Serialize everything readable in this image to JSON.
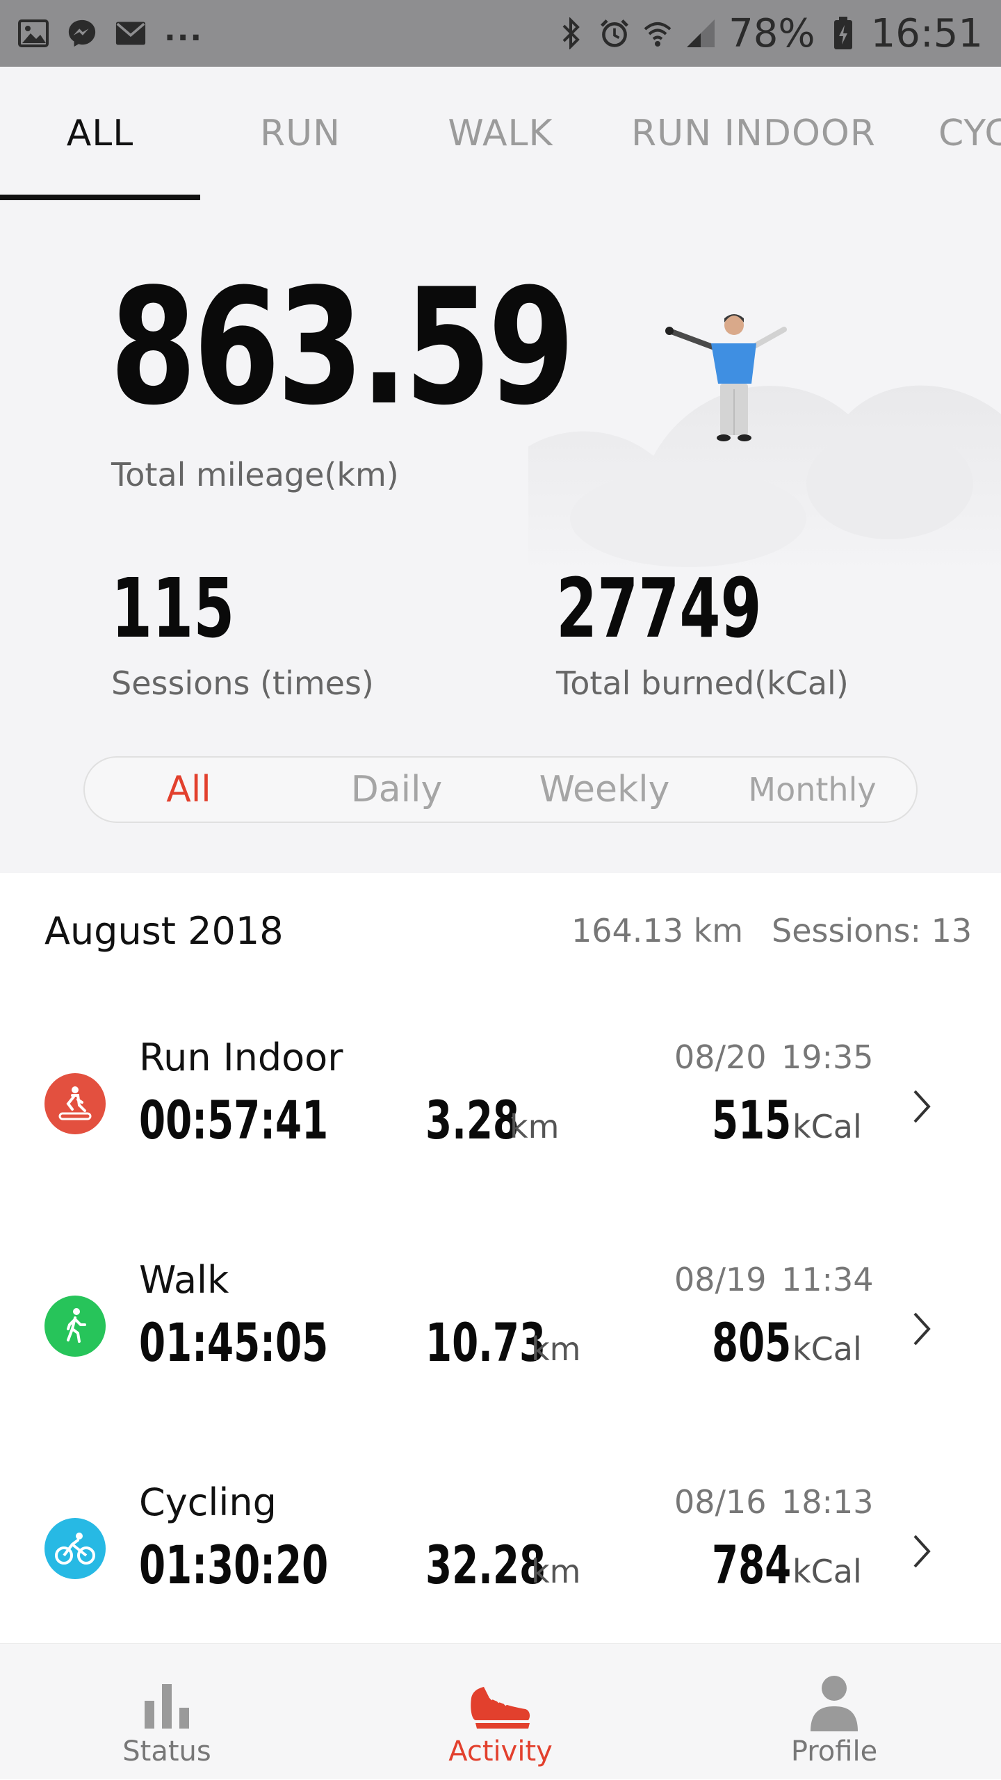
{
  "status_bar": {
    "battery": "78%",
    "time": "16:51",
    "more": "..."
  },
  "tabs": [
    {
      "label": "ALL",
      "active": true
    },
    {
      "label": "RUN",
      "active": false
    },
    {
      "label": "WALK",
      "active": false
    },
    {
      "label": "RUN INDOOR",
      "active": false
    },
    {
      "label": "CYC",
      "active": false
    }
  ],
  "summary": {
    "total_mileage": "863.59",
    "total_mileage_label": "Total mileage(km)",
    "sessions": "115",
    "sessions_label": "Sessions (times)",
    "burned": "27749",
    "burned_label": "Total burned(kCal)"
  },
  "period_filter": {
    "options": [
      "All",
      "Daily",
      "Weekly",
      "Monthly"
    ],
    "selected": "All"
  },
  "month_header": {
    "title": "August 2018",
    "distance": "164.13 km",
    "sessions": "Sessions: 13"
  },
  "activities": [
    {
      "name": "Run Indoor",
      "icon": "treadmill-icon",
      "color": "#e3503f",
      "date": "08/20",
      "time": "19:35",
      "duration": "00:57:41",
      "distance": "3.28",
      "distance_unit": "km",
      "calories": "515",
      "calories_unit": "kCal"
    },
    {
      "name": "Walk",
      "icon": "walk-icon",
      "color": "#27c45a",
      "date": "08/19",
      "time": "11:34",
      "duration": "01:45:05",
      "distance": "10.73",
      "distance_unit": "km",
      "calories": "805",
      "calories_unit": "kCal"
    },
    {
      "name": "Cycling",
      "icon": "bicycle-icon",
      "color": "#27b9e4",
      "date": "08/16",
      "time": "18:13",
      "duration": "01:30:20",
      "distance": "32.28",
      "distance_unit": "km",
      "calories": "784",
      "calories_unit": "kCal"
    }
  ],
  "bottom_nav": [
    {
      "label": "Status",
      "icon": "bar-chart-icon",
      "active": false
    },
    {
      "label": "Activity",
      "icon": "shoe-icon",
      "active": true
    },
    {
      "label": "Profile",
      "icon": "person-icon",
      "active": false
    }
  ],
  "colors": {
    "accent": "#e2402d",
    "status_bar": "#8e8e90",
    "header_bg": "#f4f4f6"
  }
}
